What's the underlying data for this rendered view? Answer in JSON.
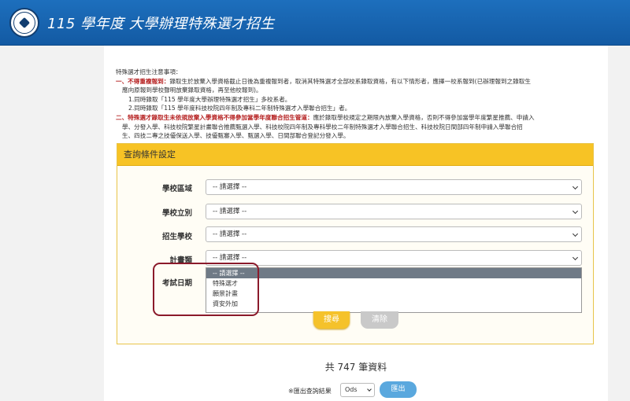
{
  "header": {
    "title": "115 學年度 大學辦理特殊選才招生",
    "logo_icon": "university-seal-icon"
  },
  "notice": {
    "title": "特殊選才招生注意事項：",
    "item1_red": "一、不得重複報到：",
    "item1_text": "錄取生於放棄入學資格截止日後為重複報到者，取消其特殊選才全部校系錄取資格，有以下情形者，應擇一校系報到(已辦理報到之錄取生",
    "item1_cont": "應向原報到學校聲明放棄錄取資格，再至他校報到)。",
    "item1_sub1": "1.同時錄取「115 學年度大學辦理特殊選才招生」多校系者。",
    "item1_sub2": "2.同時錄取「115 學年度科技校院四年制及專科二年制特殊選才入學聯合招生」者。",
    "item2_red": "二、特殊選才錄取生未依規放棄入學資格不得參加當學年度聯合招生管道：",
    "item2_text": "應於錄取學校規定之期限內放棄入學資格，否則不得參加當學年度繁星推薦、申請入",
    "item2_cont1": "學、分發入學、科技校院繁星計畫聯合推薦甄選入學、科技校院四年制及專科學校二年制特殊選才入學聯合招生、科技校院日間部四年制申請入學聯合招",
    "item2_cont2": "生、四技二專之技優保送入學、技優甄審入學、甄選入學、日間部聯合登記分發入學。"
  },
  "panel": {
    "title": "查詢條件設定",
    "fields": [
      {
        "label": "學校區域",
        "value": "-- 請選擇 --"
      },
      {
        "label": "學校立別",
        "value": "-- 請選擇 --"
      },
      {
        "label": "招生學校",
        "value": "-- 請選擇 --"
      },
      {
        "label": "計畫類",
        "value": "-- 請選擇 --"
      },
      {
        "label": "考試日期",
        "value": ""
      }
    ],
    "dropdown_options": [
      "-- 請選擇 --",
      "特殊選才",
      "願景計畫",
      "資安外加"
    ],
    "search_label": "搜尋",
    "clear_label": "清除"
  },
  "results": {
    "total_text": "共 747 筆資料",
    "export_label": "※匯出查詢結果",
    "export_format": "Ods",
    "export_button": "匯出"
  },
  "colors": {
    "header_blue": "#1d6fbd",
    "panel_yellow": "#f7c325",
    "notice_red": "#b51f1f",
    "highlight": "#8b1a2b",
    "export_blue": "#5aa8de"
  }
}
